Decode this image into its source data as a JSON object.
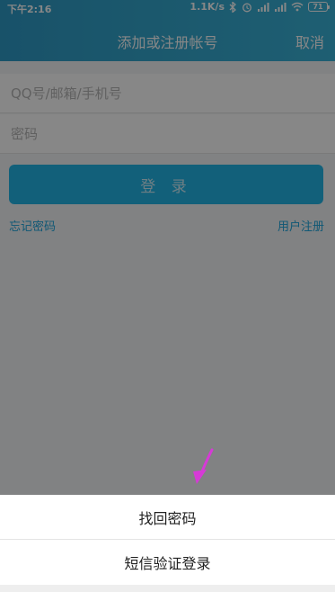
{
  "status_bar": {
    "time": "下午2:16",
    "network_speed": "1.1K/s",
    "battery_level": "71"
  },
  "nav": {
    "title": "添加或注册帐号",
    "cancel_label": "取消"
  },
  "form": {
    "account_placeholder": "QQ号/邮箱/手机号",
    "password_placeholder": "密码",
    "login_label": "登 录",
    "forgot_label": "忘记密码",
    "register_label": "用户注册"
  },
  "sheet": {
    "items": [
      {
        "label": "找回密码"
      },
      {
        "label": "短信验证登录"
      }
    ]
  },
  "colors": {
    "header": "#34a8cf",
    "accent": "#23b6e6",
    "link": "#1fa6dd",
    "annotation": "#d63ad6"
  }
}
